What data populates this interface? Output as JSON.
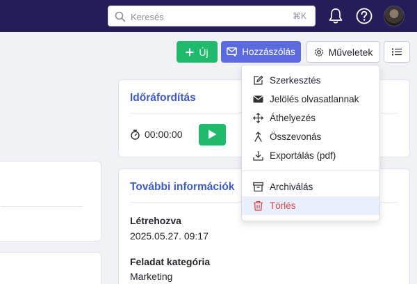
{
  "header": {
    "search_placeholder": "Keresés",
    "search_shortcut": "⌘K",
    "icons": [
      "search-icon",
      "bell-icon",
      "help-icon"
    ]
  },
  "toolbar": {
    "new_label": "Új",
    "comment_label": "Hozzászólás",
    "actions_label": "Műveletek"
  },
  "actions_menu": {
    "items": [
      {
        "label": "Szerkesztés",
        "icon": "edit-icon"
      },
      {
        "label": "Jelölés olvasatlannak",
        "icon": "envelope-icon"
      },
      {
        "label": "Áthelyezés",
        "icon": "move-icon"
      },
      {
        "label": "Összevonás",
        "icon": "merge-icon"
      },
      {
        "label": "Exportálás (pdf)",
        "icon": "download-icon"
      },
      {
        "label": "Archiválás",
        "icon": "archive-icon"
      },
      {
        "label": "Törlés",
        "icon": "trash-icon"
      }
    ]
  },
  "time_card": {
    "title": "Időráfordítás",
    "timer": "00:00:00"
  },
  "info_card": {
    "title": "További információk",
    "created_label": "Létrehozva",
    "created_value": "2025.05.27. 09:17",
    "category_label": "Feladat kategória",
    "category_value": "Marketing"
  },
  "colors": {
    "navbar": "#241d57",
    "primary": "#5b6bdf",
    "success": "#1fba6b",
    "title": "#3c5bc6",
    "danger": "#e0454a"
  }
}
